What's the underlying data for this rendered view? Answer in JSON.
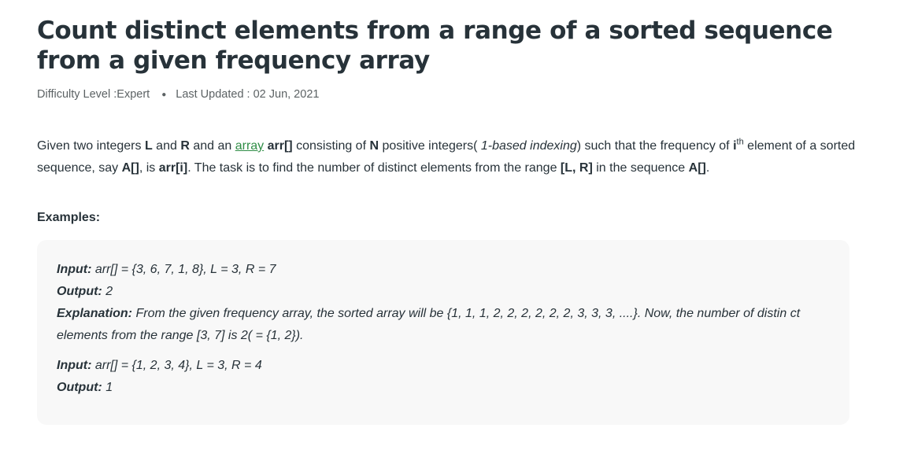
{
  "article": {
    "title": "Count distinct elements from a range of a sorted sequence from a given frequency array",
    "difficulty_label": "Difficulty Level : ",
    "difficulty_value": "Expert",
    "updated_label": "Last Updated : ",
    "updated_value": "02 Jun, 2021"
  },
  "description": {
    "t1": "Given two integers ",
    "L": "L",
    "t2": " and ",
    "R": "R",
    "t3": " and an ",
    "link_array": "array",
    "t4": " ",
    "arr": "arr[]",
    "t5": " consisting of ",
    "N": "N",
    "t6": " positive integers(",
    "italic_indexing": " 1-based indexing",
    "t7": ") such that the frequency of ",
    "i": "i",
    "sup_th": "th",
    "t8": " element of a sorted sequence, say ",
    "A": "A[]",
    "t9": ", is ",
    "arri": "arr[i]",
    "t10": ". The task is to find the number of distinct elements from the range ",
    "range": "[L, R]",
    "t11": " in the sequence ",
    "A2": "A[]",
    "t12": "."
  },
  "examples": {
    "heading": "Examples:",
    "ex1": {
      "input_label": "Input:",
      "input_value": " arr[] = {3, 6, 7, 1, 8}, L = 3, R = 7",
      "output_label": "Output:",
      "output_value": " 2",
      "explanation_label": "Explanation:",
      "explanation_value": " From the given frequency array, the sorted array will be {1, 1, 1, 2, 2, 2, 2, 2, 2, 3, 3, 3, ....}. Now, the number of distin ct elements from the range [3, 7] is 2( = {1, 2})."
    },
    "ex2": {
      "input_label": "Input:",
      "input_value": " arr[] = {1, 2, 3, 4}, L = 3, R = 4",
      "output_label": "Output:",
      "output_value": " 1"
    }
  }
}
